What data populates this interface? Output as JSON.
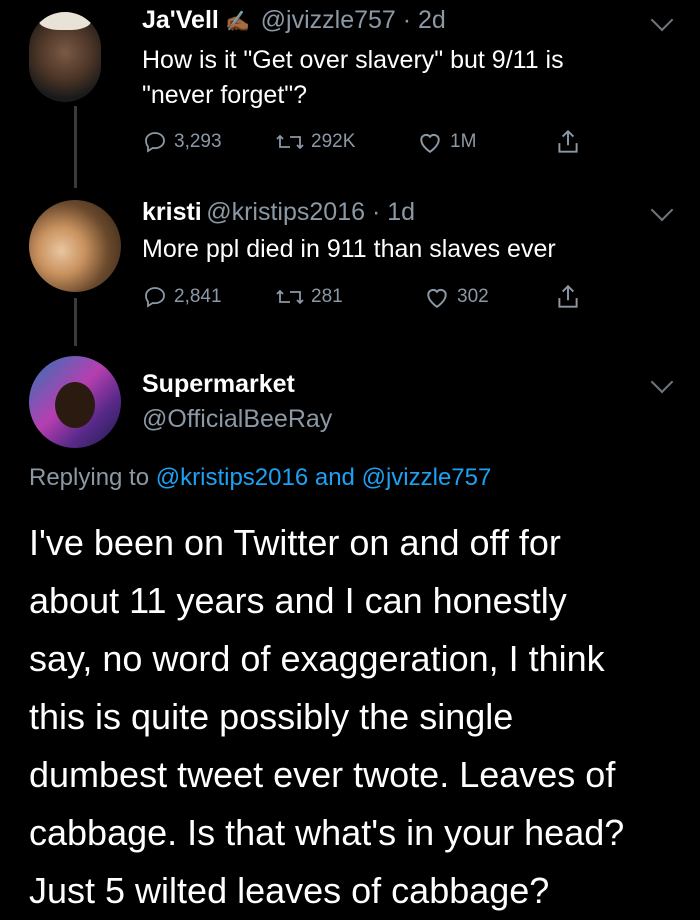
{
  "tweet1": {
    "name": "Ja'Vell",
    "handle_time": "@jvizzle757 · 2d",
    "text_line1": "How is it \"Get over slavery\" but 9/11 is",
    "text_line2": "\"never forget\"?",
    "replies": "3,293",
    "retweets": "292K",
    "likes": "1M"
  },
  "tweet2": {
    "name": "kristi",
    "handle_time": "@kristips2016 · 1d",
    "text": "More ppl died in 911 than slaves ever",
    "replies": "2,841",
    "retweets": "281",
    "likes": "302"
  },
  "tweet3": {
    "name": "Supermarket",
    "handle": "@OfficialBeeRay",
    "replying_prefix": "Replying to",
    "reply_user1": "@kristips2016",
    "reply_and": "and",
    "reply_user2": "@jvizzle757",
    "lines": [
      "I've been on Twitter on and off for",
      "about 11 years and I can honestly",
      "say, no word of exaggeration, I think",
      "this is quite possibly the single",
      "dumbest tweet ever twote. Leaves of",
      "cabbage. Is that what's in your head?",
      "Just 5 wilted leaves of cabbage?"
    ]
  }
}
